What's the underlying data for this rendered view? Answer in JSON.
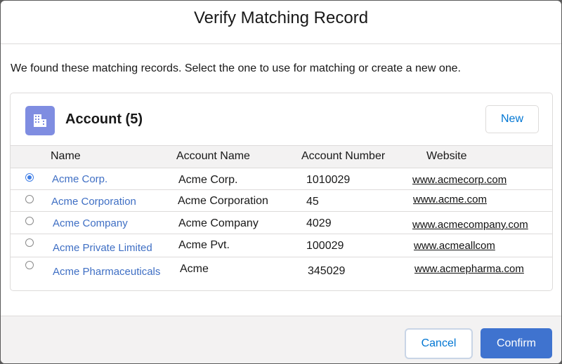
{
  "modal": {
    "title": "Verify Matching Record",
    "intro": "We found these matching records. Select the one to use for matching or create a new one."
  },
  "card": {
    "icon": "account-building-icon",
    "title": "Account (5)",
    "new_label": "New"
  },
  "table": {
    "headers": [
      "Name",
      "Account Name",
      "Account Number",
      "Website"
    ],
    "selected_index": 0,
    "rows": [
      {
        "name": "Acme Corp.",
        "account_name": "Acme Corp.",
        "account_number": "1010029",
        "website": "www.acmecorp.com"
      },
      {
        "name": "Acme Corporation",
        "account_name": "Acme Corporation",
        "account_number": "45",
        "website": "www.acme.com"
      },
      {
        "name": "Acme Company",
        "account_name": "Acme Company",
        "account_number": "4029",
        "website": "www.acmecompany.com"
      },
      {
        "name": "Acme Private Limited",
        "account_name": "Acme Pvt.",
        "account_number": "100029",
        "website": "www.acmeallcom"
      },
      {
        "name": "Acme Pharmaceuticals",
        "account_name": "Acme",
        "account_number": "345029",
        "website": "www.acmepharma.com"
      }
    ]
  },
  "footer": {
    "cancel_label": "Cancel",
    "confirm_label": "Confirm"
  },
  "colors": {
    "accent": "#0176d3",
    "icon_bg": "#7f8de1",
    "confirm_bg": "#3f73cf"
  }
}
